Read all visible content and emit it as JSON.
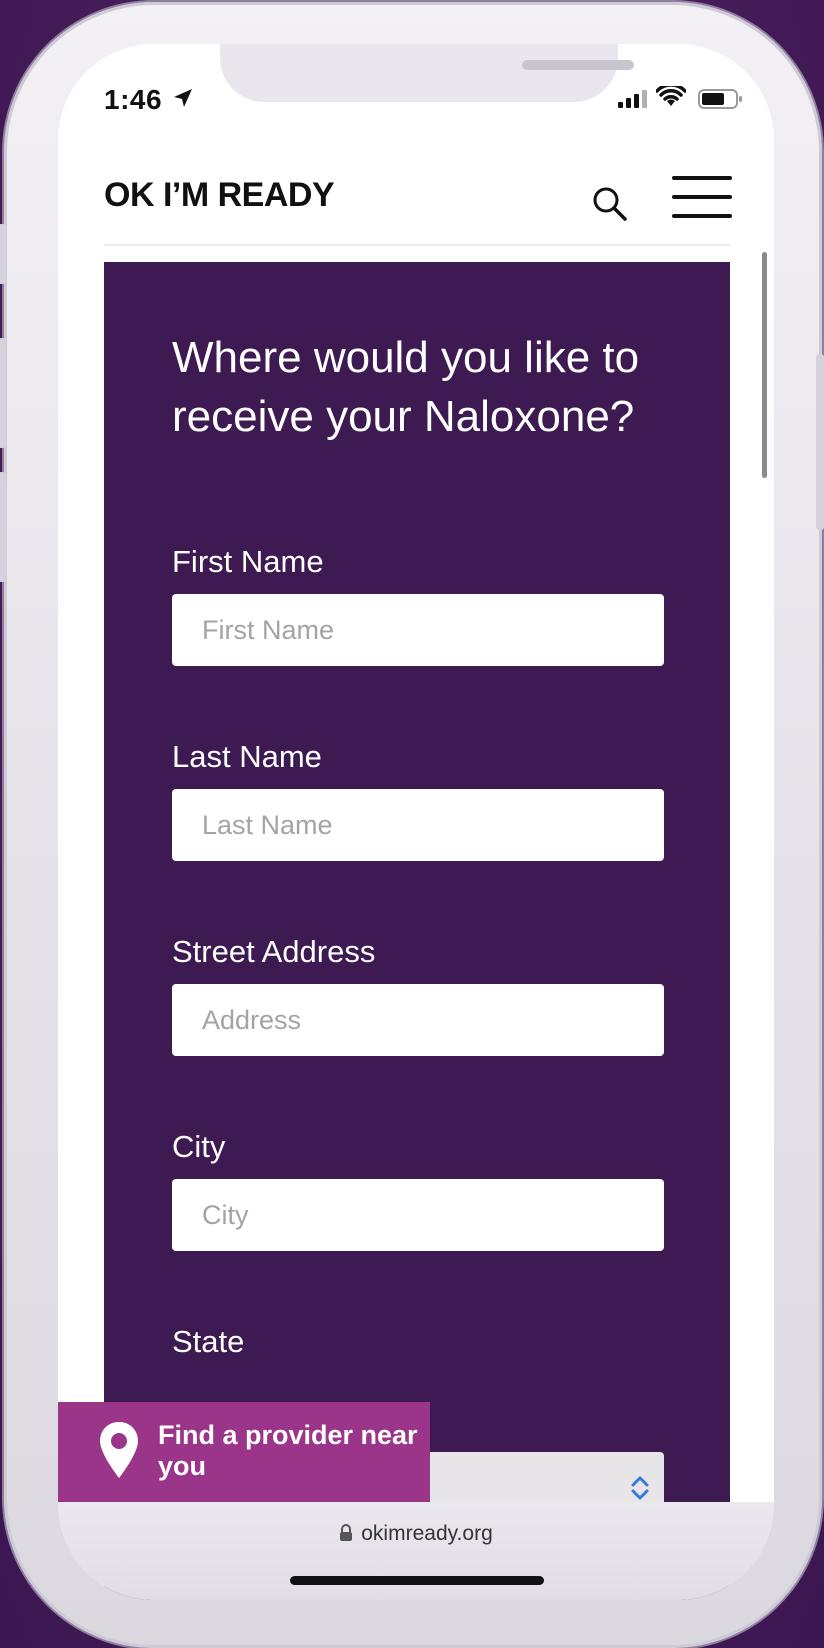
{
  "status_bar": {
    "time": "1:46"
  },
  "header": {
    "brand": "OK I’M READY",
    "icons": [
      "search-icon",
      "hamburger-menu-icon"
    ]
  },
  "form": {
    "heading": "Where would you like to receive your Naloxone?",
    "fields": [
      {
        "label": "First Name",
        "placeholder": "First Name"
      },
      {
        "label": "Last Name",
        "placeholder": "Last Name"
      },
      {
        "label": "Street Address",
        "placeholder": "Address"
      },
      {
        "label": "City",
        "placeholder": "City"
      }
    ],
    "state": {
      "label": "State",
      "value": ""
    }
  },
  "provider_bar": {
    "text": "Find a provider near you",
    "icon": "map-pin-icon"
  },
  "browser": {
    "url": "okimready.org"
  },
  "colors": {
    "panel": "#3d1a51",
    "provider_bar": "#9b3589",
    "background": "#4a1f5c"
  }
}
